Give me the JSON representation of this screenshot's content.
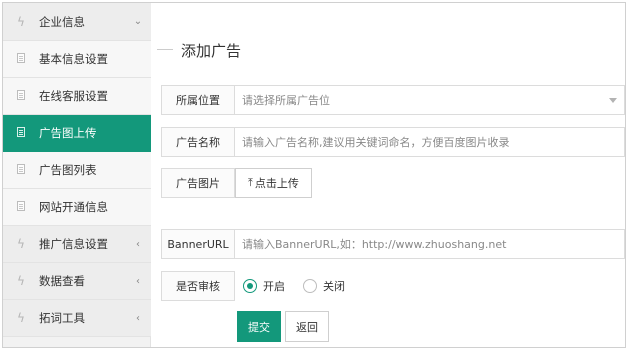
{
  "sidebar": {
    "group_company": {
      "label": "企业信息",
      "arrow": "⌄"
    },
    "items": [
      {
        "label": "基本信息设置"
      },
      {
        "label": "在线客服设置"
      },
      {
        "label": "广告图上传"
      },
      {
        "label": "广告图列表"
      },
      {
        "label": "网站开通信息"
      }
    ],
    "group_promo": {
      "label": "推广信息设置",
      "arrow": "‹"
    },
    "group_data": {
      "label": "数据查看",
      "arrow": "‹"
    },
    "group_tools": {
      "label": "拓词工具",
      "arrow": "‹"
    }
  },
  "main": {
    "title": "添加广告",
    "position": {
      "label": "所属位置",
      "placeholder": "请选择所属广告位"
    },
    "name": {
      "label": "广告名称",
      "placeholder": "请输入广告名称,建议用关键词命名，方便百度图片收录"
    },
    "image": {
      "label": "广告图片",
      "upload_label": "点击上传",
      "upload_icon": "⤒"
    },
    "banner": {
      "label": "BannerURL",
      "placeholder": "请输入BannerURL,如：http://www.zhuoshang.net"
    },
    "review": {
      "label": "是否审核",
      "option_on": "开启",
      "option_off": "关闭"
    },
    "submit_label": "提交",
    "back_label": "返回"
  },
  "colors": {
    "accent": "#13987b"
  },
  "icons": {
    "group": "bolt-icon",
    "item": "document-icon"
  }
}
